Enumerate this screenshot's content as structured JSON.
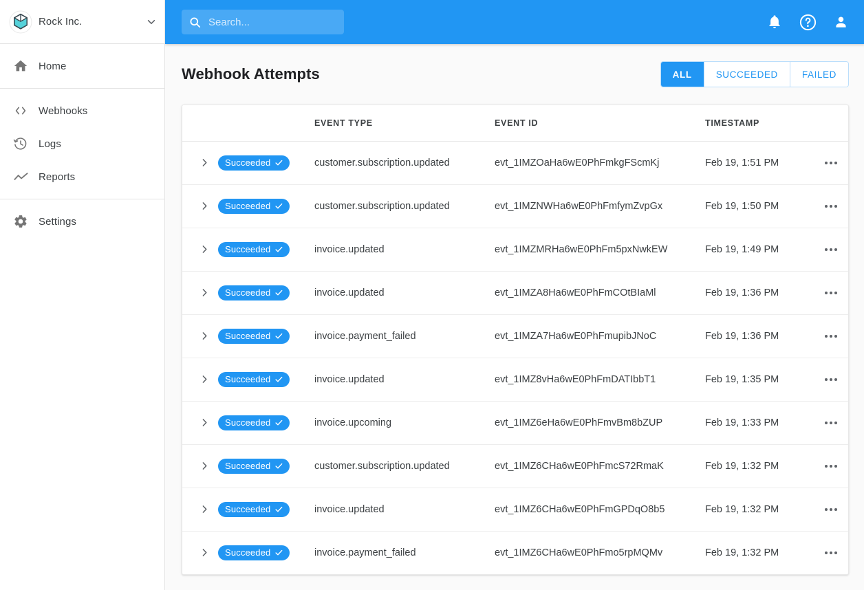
{
  "sidebar": {
    "brand": {
      "name": "Rock Inc.",
      "logo_icon": "cube-hexagon-logo",
      "chevron_icon": "chevron-down-icon",
      "logo_accent": "#4dd0d8"
    },
    "groups": [
      {
        "items": [
          {
            "label": "Home",
            "icon": "home-icon"
          }
        ]
      },
      {
        "items": [
          {
            "label": "Webhooks",
            "icon": "code-brackets-icon"
          },
          {
            "label": "Logs",
            "icon": "history-clock-icon"
          },
          {
            "label": "Reports",
            "icon": "trending-line-icon"
          }
        ]
      },
      {
        "items": [
          {
            "label": "Settings",
            "icon": "gear-icon"
          }
        ]
      }
    ]
  },
  "topbar": {
    "background": "#2196f3",
    "search": {
      "value": "",
      "placeholder": "Search...",
      "icon": "search-icon"
    },
    "icons": [
      {
        "name": "notifications-bell-icon"
      },
      {
        "name": "help-circle-icon"
      },
      {
        "name": "account-person-icon"
      }
    ]
  },
  "page": {
    "title": "Webhook Attempts",
    "filters": [
      {
        "label": "ALL",
        "active": true
      },
      {
        "label": "SUCCEEDED",
        "active": false
      },
      {
        "label": "FAILED",
        "active": false
      }
    ]
  },
  "table": {
    "columns": [
      "",
      "",
      "EVENT TYPE",
      "EVENT ID",
      "TIMESTAMP",
      ""
    ],
    "row_icons": {
      "expand": "chevron-right-icon",
      "status_check": "check-icon",
      "overflow": "more-horizontal-icon"
    },
    "rows": [
      {
        "status": "Succeeded",
        "event_type": "customer.subscription.updated",
        "event_id": "evt_1IMZOaHa6wE0PhFmkgFScmKj",
        "timestamp": "Feb 19, 1:51 PM"
      },
      {
        "status": "Succeeded",
        "event_type": "customer.subscription.updated",
        "event_id": "evt_1IMZNWHa6wE0PhFmfymZvpGx",
        "timestamp": "Feb 19, 1:50 PM"
      },
      {
        "status": "Succeeded",
        "event_type": "invoice.updated",
        "event_id": "evt_1IMZMRHa6wE0PhFm5pxNwkEW",
        "timestamp": "Feb 19, 1:49 PM"
      },
      {
        "status": "Succeeded",
        "event_type": "invoice.updated",
        "event_id": "evt_1IMZA8Ha6wE0PhFmCOtBIaMl",
        "timestamp": "Feb 19, 1:36 PM"
      },
      {
        "status": "Succeeded",
        "event_type": "invoice.payment_failed",
        "event_id": "evt_1IMZA7Ha6wE0PhFmupibJNoC",
        "timestamp": "Feb 19, 1:36 PM"
      },
      {
        "status": "Succeeded",
        "event_type": "invoice.updated",
        "event_id": "evt_1IMZ8vHa6wE0PhFmDATIbbT1",
        "timestamp": "Feb 19, 1:35 PM"
      },
      {
        "status": "Succeeded",
        "event_type": "invoice.upcoming",
        "event_id": "evt_1IMZ6eHa6wE0PhFmvBm8bZUP",
        "timestamp": "Feb 19, 1:33 PM"
      },
      {
        "status": "Succeeded",
        "event_type": "customer.subscription.updated",
        "event_id": "evt_1IMZ6CHa6wE0PhFmcS72RmaK",
        "timestamp": "Feb 19, 1:32 PM"
      },
      {
        "status": "Succeeded",
        "event_type": "invoice.updated",
        "event_id": "evt_1IMZ6CHa6wE0PhFmGPDqO8b5",
        "timestamp": "Feb 19, 1:32 PM"
      },
      {
        "status": "Succeeded",
        "event_type": "invoice.payment_failed",
        "event_id": "evt_1IMZ6CHa6wE0PhFmo5rpMQMv",
        "timestamp": "Feb 19, 1:32 PM"
      }
    ]
  },
  "colors": {
    "accent": "#2196f3",
    "page_bg": "#fafafa",
    "card_bg": "#ffffff",
    "text": "#3c4043"
  }
}
